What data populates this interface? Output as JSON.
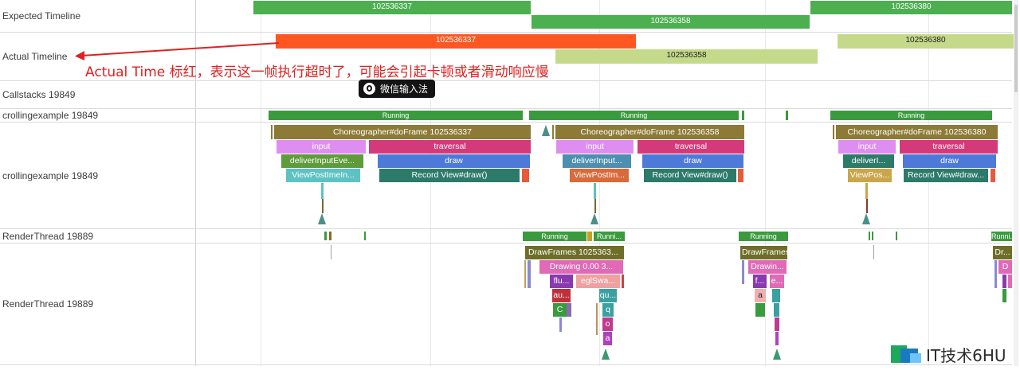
{
  "colors": {
    "expected_green": "#4caf50",
    "actual_red": "#ff5722",
    "actual_olive": "#c5d98a",
    "running_green": "#3a9a3e",
    "choreographer": "#8c7a36",
    "input_pink": "#de8ef0",
    "traversal_magenta": "#d43a7a",
    "deliver_green": "#5f9b3a",
    "draw_blue": "#4d7ad9",
    "viewpost_teal": "#5ec2c2",
    "record_teal": "#2c7a6a",
    "annotation_red": "#e02020"
  },
  "tracks": {
    "expected_timeline": "Expected Timeline",
    "actual_timeline": "Actual Timeline",
    "callstacks": "Callstacks 19849",
    "main_thread_state": "crollingexample 19849",
    "main_thread": "crollingexample 19849",
    "render_thread_state": "RenderThread 19889",
    "render_thread": "RenderThread 19889"
  },
  "expected": {
    "frame1": "102536337",
    "frame2": "102536358",
    "frame3": "102536380"
  },
  "actual": {
    "frame1": "102536337",
    "frame2": "102536358",
    "frame3": "102536380"
  },
  "annotation": {
    "text": "Actual Time 标红，表示这一帧执行超时了，可能会引起卡顿或者滑动响应慢"
  },
  "ime_badge": {
    "icon": "ime-logo-icon",
    "label": "微信输入法"
  },
  "main_state": {
    "running": "Running"
  },
  "slices": {
    "choreographer1": "Choreographer#doFrame 102536337",
    "choreographer2": "Choreographer#doFrame 102536358",
    "choreographer3": "Choreographer#doFrame 102536380",
    "input": "input",
    "traversal": "traversal",
    "deliver1": "deliverInputEve...",
    "deliver2": "deliverInput...",
    "deliver3": "deliverI...",
    "draw": "draw",
    "viewpost1": "ViewPostImeIn...",
    "viewpost2": "ViewPostIm...",
    "viewpost3": "ViewPos...",
    "record1": "Record View#draw()",
    "record2": "Record View#draw()",
    "record3": "Record View#draw..."
  },
  "render_state": {
    "running": "Running",
    "running_short": "Runni..."
  },
  "render_slices": {
    "drawframes1": "DrawFrames 1025363...",
    "drawframes2": "DrawFrames",
    "drawframes3": "Dr...",
    "drawing1": "Drawing  0.00 3...",
    "drawing2": "Drawin...",
    "drawing3": "D",
    "flu": "flu...",
    "eglswa": "eglSwa...",
    "au": "au...",
    "qu": "qu...",
    "c": "C",
    "q": "q",
    "o": "o",
    "a": "a",
    "f": "f...",
    "e": "e...",
    "a2": "a"
  },
  "watermark": {
    "logo": "it-6hu-logo-icon",
    "text": "IT技术6HU"
  }
}
